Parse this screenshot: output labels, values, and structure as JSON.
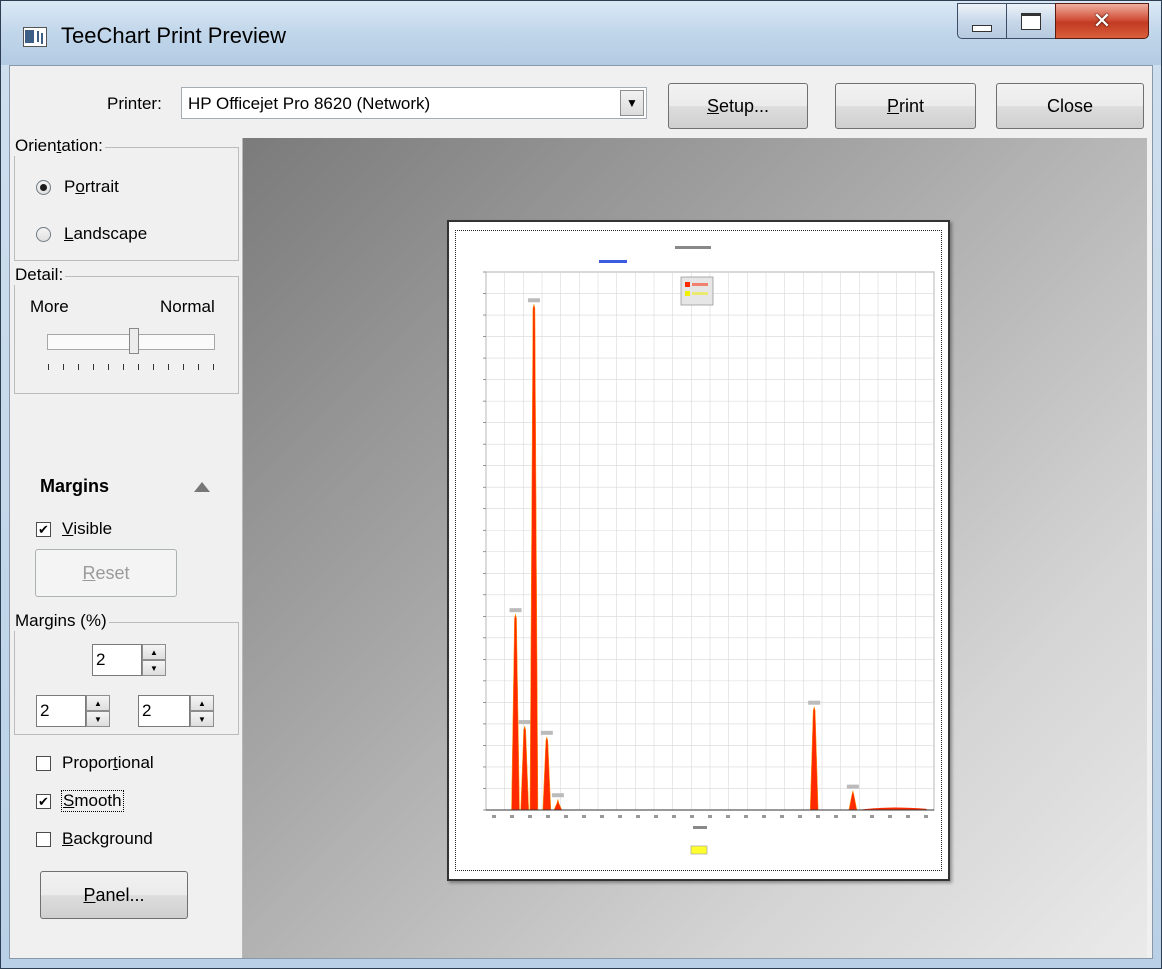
{
  "window": {
    "title": "TeeChart Print Preview"
  },
  "toolbar": {
    "printer_label": "Printer:",
    "printer_value": "HP Officejet Pro 8620 (Network)",
    "setup_hotkey": "S",
    "setup_rest": "etup...",
    "print_hotkey": "P",
    "print_rest": "rint",
    "close_label": "Close"
  },
  "orientation": {
    "title_pre": "Orien",
    "title_hotkey": "t",
    "title_post": "ation:",
    "portrait_pre": "P",
    "portrait_hotkey": "o",
    "portrait_post": "rtrait",
    "landscape_hotkey": "L",
    "landscape_rest": "andscape",
    "selected": "Portrait"
  },
  "detail": {
    "title": "Detail:",
    "more": "More",
    "normal": "Normal",
    "level": 0.53
  },
  "margins": {
    "header": "Margins",
    "visible_hotkey": "V",
    "visible_rest": "isible",
    "visible_checked": true,
    "reset_hotkey": "R",
    "reset_rest": "eset",
    "percent_title": "Margins (%)",
    "top": "2",
    "left": "2",
    "right": "2"
  },
  "options": {
    "proportional_pre": "Propor",
    "proportional_hotkey": "t",
    "proportional_post": "ional",
    "proportional_checked": false,
    "smooth_hotkey": "S",
    "smooth_rest": "mooth",
    "smooth_checked": true,
    "background_hotkey": "B",
    "background_rest": "ackground",
    "background_checked": false
  },
  "panel_button": {
    "hotkey": "P",
    "rest": "anel..."
  },
  "colors": {
    "series": "#ff2a00",
    "series_highlight": "#ff9900",
    "legend_yellow": "#f0f000",
    "accent": "#3b5be0"
  },
  "chart_data": {
    "type": "line",
    "peaks": [
      {
        "x": 1.3,
        "y": 182
      },
      {
        "x": 1.8,
        "y": 78
      },
      {
        "x": 2.3,
        "y": 470
      },
      {
        "x": 3.0,
        "y": 68
      },
      {
        "x": 3.6,
        "y": 10
      },
      {
        "x": 17.5,
        "y": 96
      },
      {
        "x": 19.6,
        "y": 18
      }
    ],
    "ylim": [
      0,
      500
    ],
    "xlim": [
      -0.3,
      24.0
    ],
    "grid": true
  }
}
